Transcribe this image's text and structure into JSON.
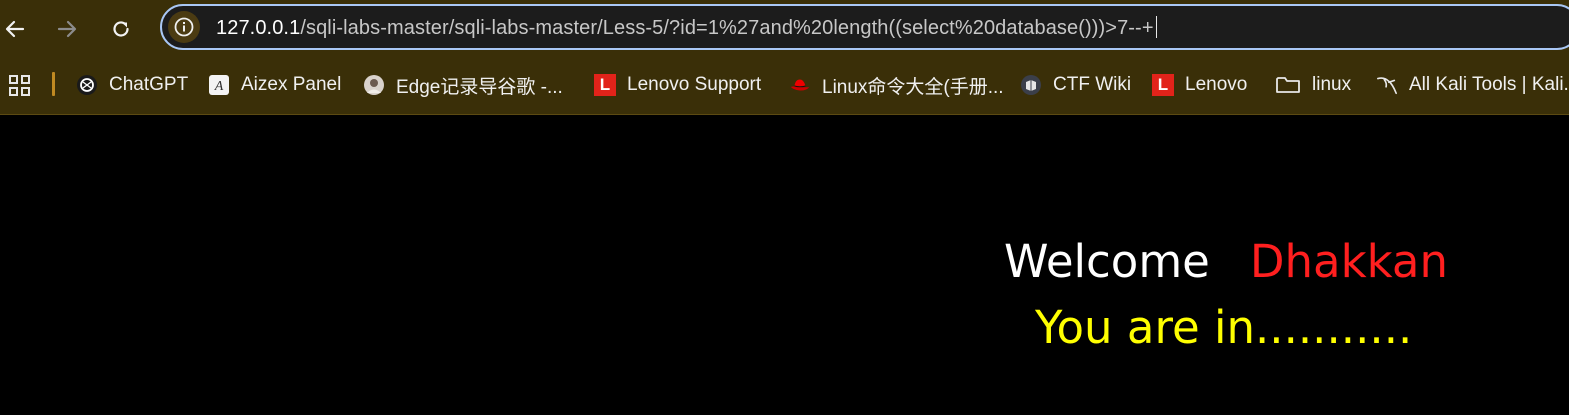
{
  "address_bar": {
    "url_host": "127.0.0.1",
    "url_path": "/sqli-labs-master/sqli-labs-master/Less-5/?id=1%27and%20length((select%20database()))>7--+"
  },
  "bookmarks": [
    {
      "label": "ChatGPT",
      "icon": "chatgpt-icon"
    },
    {
      "label": "Aizex Panel",
      "icon": "aizex-icon"
    },
    {
      "label": "Edge记录导谷歌 -...",
      "icon": "avatar-icon"
    },
    {
      "label": "Lenovo Support",
      "icon": "lenovo-icon"
    },
    {
      "label": "Linux命令大全(手册...",
      "icon": "redhat-icon"
    },
    {
      "label": "CTF Wiki",
      "icon": "ctf-wiki-icon"
    },
    {
      "label": "Lenovo",
      "icon": "lenovo-icon"
    },
    {
      "label": "linux",
      "icon": "folder-icon"
    },
    {
      "label": "All Kali Tools | Kali...",
      "icon": "kali-icon"
    }
  ],
  "page": {
    "welcome": "Welcome",
    "name": "Dhakkan",
    "status": "You are in..........."
  },
  "colors": {
    "welcome": "#ffffff",
    "name": "#ff1f1f",
    "status": "#ffff00",
    "chrome_bg": "#3a2f08"
  }
}
